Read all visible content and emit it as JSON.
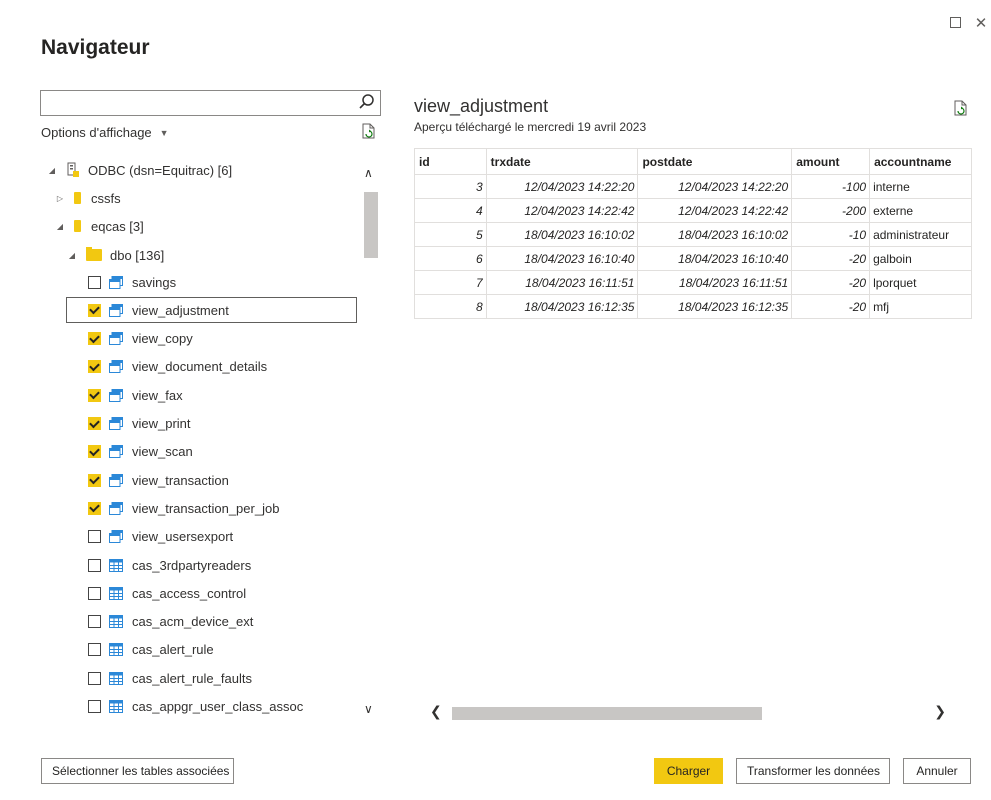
{
  "window": {
    "title": "Navigateur",
    "maximize_icon": "maximize-icon",
    "close_icon": "close-icon"
  },
  "left": {
    "search": {
      "value": "",
      "placeholder": ""
    },
    "options_label": "Options d'affichage",
    "tree": {
      "root": "ODBC (dsn=Equitrac) [6]",
      "db1": "cssfs",
      "db2": "eqcas [3]",
      "schema": "dbo [136]",
      "items": [
        {
          "label": "savings",
          "type": "view",
          "checked": false
        },
        {
          "label": "view_adjustment",
          "type": "view",
          "checked": true
        },
        {
          "label": "view_copy",
          "type": "view",
          "checked": true
        },
        {
          "label": "view_document_details",
          "type": "view",
          "checked": true
        },
        {
          "label": "view_fax",
          "type": "view",
          "checked": true
        },
        {
          "label": "view_print",
          "type": "view",
          "checked": true
        },
        {
          "label": "view_scan",
          "type": "view",
          "checked": true
        },
        {
          "label": "view_transaction",
          "type": "view",
          "checked": true
        },
        {
          "label": "view_transaction_per_job",
          "type": "view",
          "checked": true
        },
        {
          "label": "view_usersexport",
          "type": "view",
          "checked": false
        },
        {
          "label": "cas_3rdpartyreaders",
          "type": "table",
          "checked": false
        },
        {
          "label": "cas_access_control",
          "type": "table",
          "checked": false
        },
        {
          "label": "cas_acm_device_ext",
          "type": "table",
          "checked": false
        },
        {
          "label": "cas_alert_rule",
          "type": "table",
          "checked": false
        },
        {
          "label": "cas_alert_rule_faults",
          "type": "table",
          "checked": false
        },
        {
          "label": "cas_appgr_user_class_assoc",
          "type": "table",
          "checked": false
        }
      ]
    }
  },
  "preview": {
    "title": "view_adjustment",
    "subtitle": "Aperçu téléchargé le mercredi 19 avril 2023",
    "columns": [
      "id",
      "trxdate",
      "postdate",
      "amount",
      "accountname"
    ],
    "rows": [
      [
        "3",
        "12/04/2023 14:22:20",
        "12/04/2023 14:22:20",
        "-100",
        "interne"
      ],
      [
        "4",
        "12/04/2023 14:22:42",
        "12/04/2023 14:22:42",
        "-200",
        "externe"
      ],
      [
        "5",
        "18/04/2023 16:10:02",
        "18/04/2023 16:10:02",
        "-10",
        "administrateur"
      ],
      [
        "6",
        "18/04/2023 16:10:40",
        "18/04/2023 16:10:40",
        "-20",
        "galboin"
      ],
      [
        "7",
        "18/04/2023 16:11:51",
        "18/04/2023 16:11:51",
        "-20",
        "lporquet"
      ],
      [
        "8",
        "18/04/2023 16:12:35",
        "18/04/2023 16:12:35",
        "-20",
        "mfj"
      ]
    ]
  },
  "footer": {
    "select_related": "Sélectionner les tables associées",
    "load": "Charger",
    "transform": "Transformer les données",
    "cancel": "Annuler"
  },
  "colors": {
    "accent": "#f2c811",
    "border": "#8a8886",
    "text": "#252423"
  }
}
